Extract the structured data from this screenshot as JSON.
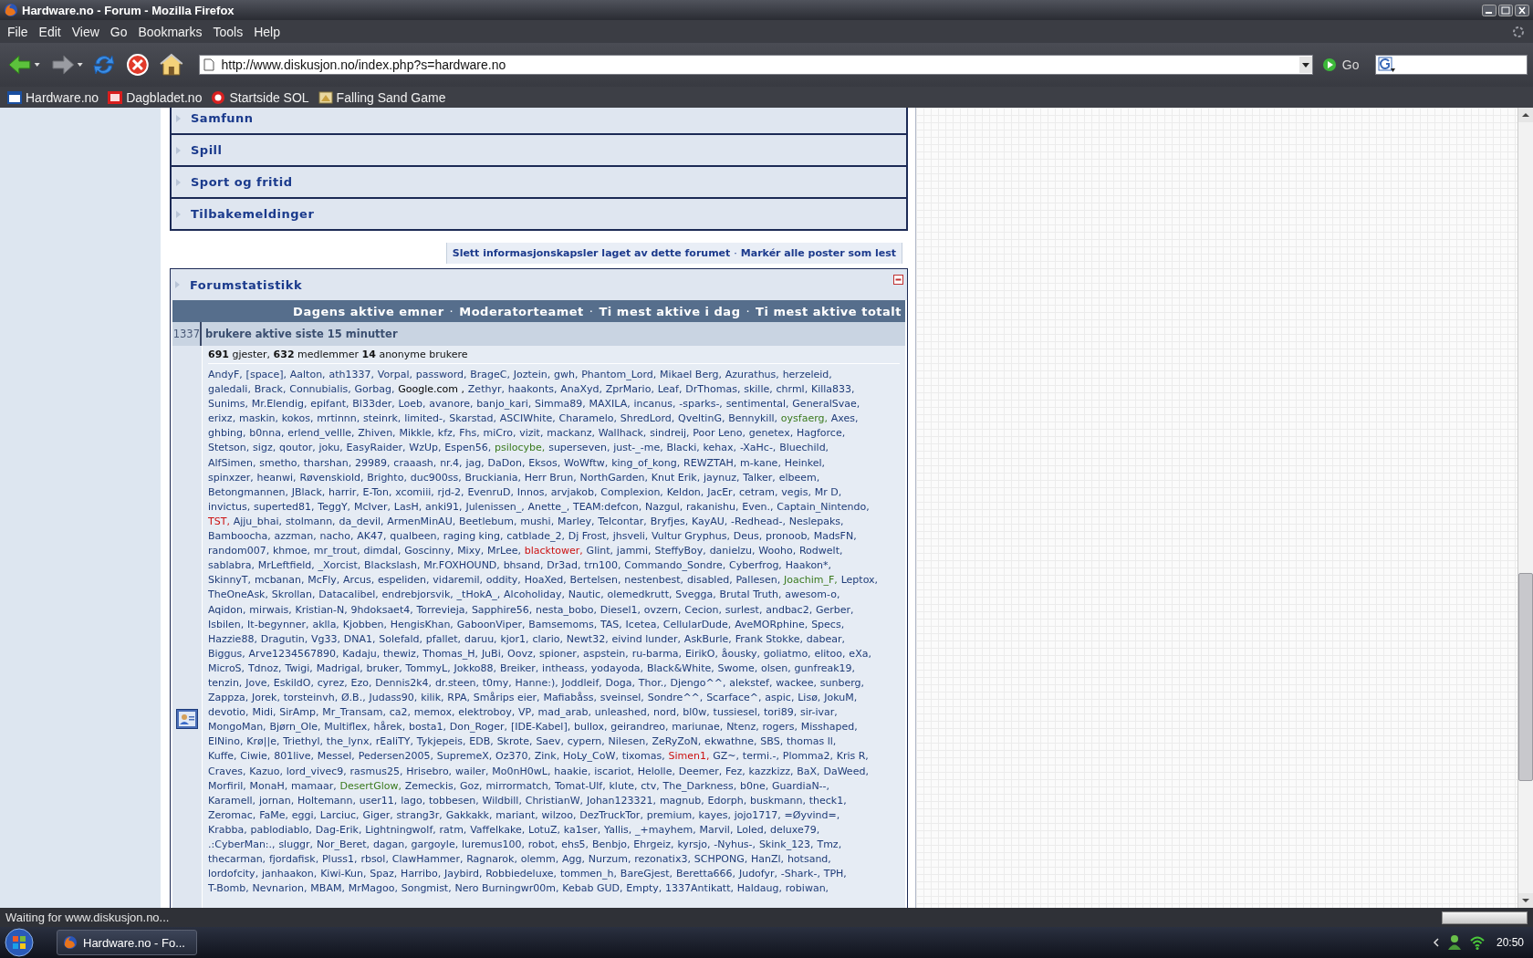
{
  "window": {
    "title": "Hardware.no - Forum - Mozilla Firefox"
  },
  "menu": [
    "File",
    "Edit",
    "View",
    "Go",
    "Bookmarks",
    "Tools",
    "Help"
  ],
  "toolbar": {
    "address": "http://www.diskusjon.no/index.php?s=hardware.no",
    "go": "Go"
  },
  "bookmarks": [
    "Hardware.no",
    "Dagbladet.no",
    "Startside SOL",
    "Falling Sand Game"
  ],
  "forum": {
    "categories": [
      "Samfunn",
      "Spill",
      "Sport og fritid",
      "Tilbakemeldinger"
    ],
    "links": [
      {
        "kind": "link",
        "text": "Slett informasjonskapsler laget av dette forumet"
      },
      {
        "kind": "separator",
        "text": "·"
      },
      {
        "kind": "link",
        "text": "Markér alle poster som lest"
      }
    ],
    "stats": {
      "title": "Forumstatistikk",
      "bar_links": [
        {
          "kind": "link",
          "text": "Dagens aktive emner"
        },
        {
          "kind": "separator",
          "text": "·"
        },
        {
          "kind": "link",
          "text": "Moderatorteamet"
        },
        {
          "kind": "separator",
          "text": "·"
        },
        {
          "kind": "link",
          "text": "Ti mest aktive i dag"
        },
        {
          "kind": "separator",
          "text": "·"
        },
        {
          "kind": "link",
          "text": "Ti mest aktive totalt"
        }
      ],
      "active_count": "1337",
      "active_label": "brukere aktive siste 15 minutter",
      "summary": "**691** gjester, **632** medlemmer **14** anonyme brukere",
      "user_lines": [
        [
          {
            "name": "AndyF,"
          },
          {
            "name": "[space],"
          },
          {
            "name": "Aalton,"
          },
          {
            "name": "ath1337,"
          },
          {
            "name": "Vorpal,"
          },
          {
            "name": "password,"
          },
          {
            "name": "BrageC,"
          },
          {
            "name": "Joztein,"
          },
          {
            "name": "gwh,"
          },
          {
            "name": "Phantom_Lord,"
          },
          {
            "name": "Mikael Berg,"
          },
          {
            "name": "Azurathus,"
          },
          {
            "name": "herzeleid,"
          }
        ],
        [
          {
            "name": "galedali,"
          },
          {
            "name": "Brack,"
          },
          {
            "name": "Connubialis,"
          },
          {
            "name": "Gorbag,"
          },
          {
            "name": "Google.com ,",
            "color": "#000000"
          },
          {
            "name": "Zethyr,"
          },
          {
            "name": "haakonts,"
          },
          {
            "name": "AnaXyd,"
          },
          {
            "name": "ZprMario,"
          },
          {
            "name": "Leaf,"
          },
          {
            "name": "DrThomas,"
          },
          {
            "name": "skille,"
          },
          {
            "name": "chrml,"
          },
          {
            "name": "Killa833,"
          }
        ],
        [
          {
            "name": "Sunims,"
          },
          {
            "name": "Mr.Elendig,"
          },
          {
            "name": "epifant,"
          },
          {
            "name": "Bl33der,"
          },
          {
            "name": "Loeb,"
          },
          {
            "name": "avanore,"
          },
          {
            "name": "banjo_kari,"
          },
          {
            "name": "Simma89,"
          },
          {
            "name": "MAXILA,"
          },
          {
            "name": "incanus,"
          },
          {
            "name": "-sparks-,"
          },
          {
            "name": "sentimental,"
          },
          {
            "name": "GeneralSvae,"
          }
        ],
        [
          {
            "name": "erixz,"
          },
          {
            "name": "maskin,"
          },
          {
            "name": "kokos,"
          },
          {
            "name": "mrtinnn,"
          },
          {
            "name": "steinrk,"
          },
          {
            "name": "limited-,"
          },
          {
            "name": "Skarstad,"
          },
          {
            "name": "ASCIWhite,"
          },
          {
            "name": "Charamelo,"
          },
          {
            "name": "ShredLord,"
          },
          {
            "name": "QveltinG,"
          },
          {
            "name": "Bennykill,"
          },
          {
            "name": "oysfaerg,",
            "color": "#3a7a1e"
          },
          {
            "name": "Axes,"
          }
        ],
        [
          {
            "name": "ghbing,"
          },
          {
            "name": "b0nna,"
          },
          {
            "name": "erlend_vellle,"
          },
          {
            "name": "Zhiven,"
          },
          {
            "name": "Mikkle,"
          },
          {
            "name": "kfz,"
          },
          {
            "name": "Fhs,"
          },
          {
            "name": "miCro,"
          },
          {
            "name": "vizit,"
          },
          {
            "name": "mackanz,"
          },
          {
            "name": "Wallhack,"
          },
          {
            "name": "sindreij,"
          },
          {
            "name": "Poor Leno,"
          },
          {
            "name": "genetex,"
          },
          {
            "name": "Hagforce,"
          }
        ],
        [
          {
            "name": "Stetson,"
          },
          {
            "name": "sigz,"
          },
          {
            "name": "qoutor,"
          },
          {
            "name": "joku,"
          },
          {
            "name": "EasyRaider,"
          },
          {
            "name": "WzUp,"
          },
          {
            "name": "Espen56,"
          },
          {
            "name": "psilocybe,",
            "color": "#3a7a1e"
          },
          {
            "name": "superseven,"
          },
          {
            "name": "just-_-me,"
          },
          {
            "name": "Blacki,"
          },
          {
            "name": "kehax,"
          },
          {
            "name": "-XaHc-,"
          },
          {
            "name": "Bluechild,"
          }
        ],
        [
          {
            "name": "AlfSimen,"
          },
          {
            "name": "smetho,"
          },
          {
            "name": "tharshan,"
          },
          {
            "name": "29989,"
          },
          {
            "name": "craaash,"
          },
          {
            "name": "nr.4,"
          },
          {
            "name": "jag,"
          },
          {
            "name": "DaDon,"
          },
          {
            "name": "Eksos,"
          },
          {
            "name": "WoWftw,"
          },
          {
            "name": "king_of_kong,"
          },
          {
            "name": "REWZTAH,"
          },
          {
            "name": "m-kane,"
          },
          {
            "name": "Heinkel,"
          }
        ],
        [
          {
            "name": "spinxzer,"
          },
          {
            "name": "heanwi,"
          },
          {
            "name": "Røvenskiold,"
          },
          {
            "name": "Brighto,"
          },
          {
            "name": "duc900ss,"
          },
          {
            "name": "Bruckiania,"
          },
          {
            "name": "Herr Brun,"
          },
          {
            "name": "NorthGarden,"
          },
          {
            "name": "Knut Erik,"
          },
          {
            "name": "jaynuz,"
          },
          {
            "name": "Talker,"
          },
          {
            "name": "elbeem,"
          }
        ],
        [
          {
            "name": "Betongmannen,"
          },
          {
            "name": "JBlack,"
          },
          {
            "name": "harrir,"
          },
          {
            "name": "E-Ton,"
          },
          {
            "name": "xcomiii,"
          },
          {
            "name": "rjd-2,"
          },
          {
            "name": "EvenruD,"
          },
          {
            "name": "Innos,"
          },
          {
            "name": "arvjakob,"
          },
          {
            "name": "Complexion,"
          },
          {
            "name": "Keldon,"
          },
          {
            "name": "JacEr,"
          },
          {
            "name": "cetram,"
          },
          {
            "name": "vegis,"
          },
          {
            "name": "Mr D,"
          }
        ],
        [
          {
            "name": "invictus,"
          },
          {
            "name": "superted81,"
          },
          {
            "name": "TeggY,"
          },
          {
            "name": "McIver,"
          },
          {
            "name": "LasH,"
          },
          {
            "name": "anki91,"
          },
          {
            "name": "Julenissen_,"
          },
          {
            "name": "Anette_,"
          },
          {
            "name": "TEAM:defcon,"
          },
          {
            "name": "Nazgul,"
          },
          {
            "name": "rakanishu,"
          },
          {
            "name": "Even.,"
          },
          {
            "name": "Captain_Nintendo,"
          }
        ],
        [
          {
            "name": "TST,",
            "color": "#cc1111"
          },
          {
            "name": "Ajju_bhai,"
          },
          {
            "name": "stolmann,"
          },
          {
            "name": "da_devil,"
          },
          {
            "name": "ArmenMinAU,"
          },
          {
            "name": "Beetlebum,"
          },
          {
            "name": "mushi,"
          },
          {
            "name": "Marley,"
          },
          {
            "name": "Telcontar,"
          },
          {
            "name": "Bryfjes,"
          },
          {
            "name": "KayAU,"
          },
          {
            "name": "-Redhead-,"
          },
          {
            "name": "Neslepaks,"
          }
        ],
        [
          {
            "name": "Bamboocha,"
          },
          {
            "name": "azzman,"
          },
          {
            "name": "nacho,"
          },
          {
            "name": "AK47,"
          },
          {
            "name": "qualbeen,"
          },
          {
            "name": "raging king,"
          },
          {
            "name": "catblade_2,"
          },
          {
            "name": "Dj Frost,"
          },
          {
            "name": "jhsveli,"
          },
          {
            "name": "Vultur Gryphus,"
          },
          {
            "name": "Deus,"
          },
          {
            "name": "pronoob,"
          },
          {
            "name": "MadsFN,"
          }
        ],
        [
          {
            "name": "random007,"
          },
          {
            "name": "khmoe,"
          },
          {
            "name": "mr_trout,"
          },
          {
            "name": "dimdal,"
          },
          {
            "name": "Goscinny,"
          },
          {
            "name": "Mixy,"
          },
          {
            "name": "MrLee,"
          },
          {
            "name": "blacktower,",
            "color": "#cc1111"
          },
          {
            "name": "Glint,"
          },
          {
            "name": "jammi,"
          },
          {
            "name": "SteffyBoy,"
          },
          {
            "name": "danielzu,"
          },
          {
            "name": "Wooho,"
          },
          {
            "name": "Rodwelt,"
          }
        ],
        [
          {
            "name": "sablabra,"
          },
          {
            "name": "MrLeftfield,"
          },
          {
            "name": "_Xorcist,"
          },
          {
            "name": "Blackslash,"
          },
          {
            "name": "Mr.FOXHOUND,"
          },
          {
            "name": "bhsand,"
          },
          {
            "name": "Dr3ad,"
          },
          {
            "name": "trn100,"
          },
          {
            "name": "Commando_Sondre,"
          },
          {
            "name": "Cyberfrog,"
          },
          {
            "name": "Haakon*,"
          }
        ],
        [
          {
            "name": "SkinnyT,"
          },
          {
            "name": "mcbanan,"
          },
          {
            "name": "McFly,"
          },
          {
            "name": "Arcus,"
          },
          {
            "name": "espeliden,"
          },
          {
            "name": "vidaremil,"
          },
          {
            "name": "oddity,"
          },
          {
            "name": "HoaXed,"
          },
          {
            "name": "Bertelsen,"
          },
          {
            "name": "nestenbest,"
          },
          {
            "name": "disabled,"
          },
          {
            "name": "Pallesen,"
          },
          {
            "name": "Joachim_F,",
            "color": "#3a7a1e"
          },
          {
            "name": "Leptox,"
          }
        ],
        [
          {
            "name": "TheOneAsk,"
          },
          {
            "name": "Skrollan,"
          },
          {
            "name": "Datacalibel,"
          },
          {
            "name": "endrebjorsvik,"
          },
          {
            "name": "_tHokA_,"
          },
          {
            "name": "Alcoholiday,"
          },
          {
            "name": "Nautic,"
          },
          {
            "name": "olemedkrutt,"
          },
          {
            "name": "Svegga,"
          },
          {
            "name": "Brutal Truth,"
          },
          {
            "name": "awesom-o,"
          }
        ],
        [
          {
            "name": "Aqidon,"
          },
          {
            "name": "mirwais,"
          },
          {
            "name": "Kristian-N,"
          },
          {
            "name": "9hdoksaet4,"
          },
          {
            "name": "Torrevieja,"
          },
          {
            "name": "Sapphire56,"
          },
          {
            "name": "nesta_bobo,"
          },
          {
            "name": "Diesel1,"
          },
          {
            "name": "ovzern,"
          },
          {
            "name": "Cecion,"
          },
          {
            "name": "surlest,"
          },
          {
            "name": "andbac2,"
          },
          {
            "name": "Gerber,"
          }
        ],
        [
          {
            "name": "Isbilen,"
          },
          {
            "name": "It-begynner,"
          },
          {
            "name": "aklla,"
          },
          {
            "name": "Kjobben,"
          },
          {
            "name": "HengisKhan,"
          },
          {
            "name": "GaboonViper,"
          },
          {
            "name": "Bamsemoms,"
          },
          {
            "name": "TAS,"
          },
          {
            "name": "Icetea,"
          },
          {
            "name": "CellularDude,"
          },
          {
            "name": "AveMORphine,"
          },
          {
            "name": "Specs,"
          }
        ],
        [
          {
            "name": "Hazzie88,"
          },
          {
            "name": "Dragutin,"
          },
          {
            "name": "Vg33,"
          },
          {
            "name": "DNA1,"
          },
          {
            "name": "Solefald,"
          },
          {
            "name": "pfallet,"
          },
          {
            "name": "daruu,"
          },
          {
            "name": "kjor1,"
          },
          {
            "name": "clario,"
          },
          {
            "name": "Newt32,"
          },
          {
            "name": "eivind lunder,"
          },
          {
            "name": "AskBurle,"
          },
          {
            "name": "Frank Stokke,"
          },
          {
            "name": "dabear,"
          }
        ],
        [
          {
            "name": "Biggus,"
          },
          {
            "name": "Arve1234567890,"
          },
          {
            "name": "Kadaju,"
          },
          {
            "name": "thewiz,"
          },
          {
            "name": "Thomas_H,"
          },
          {
            "name": "JuBi,"
          },
          {
            "name": "Oovz,"
          },
          {
            "name": "spioner,"
          },
          {
            "name": "aspstein,"
          },
          {
            "name": "ru-barma,"
          },
          {
            "name": "EirikO,"
          },
          {
            "name": "åousky,"
          },
          {
            "name": "goliatmo,"
          },
          {
            "name": "elitoo,"
          },
          {
            "name": "eXa,"
          }
        ],
        [
          {
            "name": "MicroS,"
          },
          {
            "name": "Tdnoz,"
          },
          {
            "name": "Twigi,"
          },
          {
            "name": "Madrigal,"
          },
          {
            "name": "bruker,"
          },
          {
            "name": "TommyL,"
          },
          {
            "name": "Jokko88,"
          },
          {
            "name": "Breiker,"
          },
          {
            "name": "intheass,"
          },
          {
            "name": "yodayoda,"
          },
          {
            "name": "Black&White,"
          },
          {
            "name": "Swome,"
          },
          {
            "name": "olsen,"
          },
          {
            "name": "gunfreak19,"
          }
        ],
        [
          {
            "name": "tenzin,"
          },
          {
            "name": "Jove,"
          },
          {
            "name": "EskildO,"
          },
          {
            "name": "cyrez,"
          },
          {
            "name": "Ezo,"
          },
          {
            "name": "Dennis2k4,"
          },
          {
            "name": "dr.steen,"
          },
          {
            "name": "t0my,"
          },
          {
            "name": "Hanne:),"
          },
          {
            "name": "Joddleif,"
          },
          {
            "name": "Doga,"
          },
          {
            "name": "Thor.,"
          },
          {
            "name": "Djengo^^,"
          },
          {
            "name": "alekstef,"
          },
          {
            "name": "wackee,"
          },
          {
            "name": "sunberg,"
          }
        ],
        [
          {
            "name": "Zappza,"
          },
          {
            "name": "Jorek,"
          },
          {
            "name": "torsteinvh,"
          },
          {
            "name": "Ø.B.,"
          },
          {
            "name": "Judass90,"
          },
          {
            "name": "kilik,"
          },
          {
            "name": "RPA,"
          },
          {
            "name": "Smårips eier,"
          },
          {
            "name": "Mafiabåss,"
          },
          {
            "name": "sveinsel,"
          },
          {
            "name": "Sondre^^,"
          },
          {
            "name": "Scarface^,"
          },
          {
            "name": "aspic,"
          },
          {
            "name": "Lisø,"
          },
          {
            "name": "JokuM,"
          }
        ],
        [
          {
            "name": "devotio,"
          },
          {
            "name": "Midi,"
          },
          {
            "name": "SirAmp,"
          },
          {
            "name": "Mr_Transam,"
          },
          {
            "name": "ca2,"
          },
          {
            "name": "memox,"
          },
          {
            "name": "elektroboy,"
          },
          {
            "name": "VP,"
          },
          {
            "name": "mad_arab,"
          },
          {
            "name": "unleashed,"
          },
          {
            "name": "nord,"
          },
          {
            "name": "bl0w,"
          },
          {
            "name": "tussiesel,"
          },
          {
            "name": "tori89,"
          },
          {
            "name": "sir-ivar,"
          }
        ],
        [
          {
            "name": "MongoMan,"
          },
          {
            "name": "Bjørn_Ole,"
          },
          {
            "name": "Multiflex,"
          },
          {
            "name": "hårek,"
          },
          {
            "name": "bosta1,"
          },
          {
            "name": "Don_Roger,"
          },
          {
            "name": "[IDE-Kabel],"
          },
          {
            "name": "bullox,"
          },
          {
            "name": "geirandreo,"
          },
          {
            "name": "mariunae,"
          },
          {
            "name": "Ntenz,"
          },
          {
            "name": "rogers,"
          },
          {
            "name": "Misshaped,"
          }
        ],
        [
          {
            "name": "ElNino,"
          },
          {
            "name": "Krø||e,"
          },
          {
            "name": "Triethyl,"
          },
          {
            "name": "the_lynx,"
          },
          {
            "name": "rEaliTY,"
          },
          {
            "name": "Tykjepeis,"
          },
          {
            "name": "EDB,"
          },
          {
            "name": "Skrote,"
          },
          {
            "name": "Saev,"
          },
          {
            "name": "cypern,"
          },
          {
            "name": "Nilesen,"
          },
          {
            "name": "ZeRyZoN,"
          },
          {
            "name": "ekwathne,"
          },
          {
            "name": "SBS,"
          },
          {
            "name": "thomas ll,"
          }
        ],
        [
          {
            "name": "Kuffe,"
          },
          {
            "name": "Ciwie,"
          },
          {
            "name": "801live,"
          },
          {
            "name": "Messel,"
          },
          {
            "name": "Pedersen2005,"
          },
          {
            "name": "SupremeX,"
          },
          {
            "name": "Oz370,"
          },
          {
            "name": "Zink,"
          },
          {
            "name": "HoLy_CoW,"
          },
          {
            "name": "tixomas,"
          },
          {
            "name": "Simen1,",
            "color": "#cc1111"
          },
          {
            "name": "GZ~,"
          },
          {
            "name": "termi.-,"
          },
          {
            "name": "Plomma2,"
          },
          {
            "name": "Kris R,"
          }
        ],
        [
          {
            "name": "Craves,"
          },
          {
            "name": "Kazuo,"
          },
          {
            "name": "lord_vivec9,"
          },
          {
            "name": "rasmus25,"
          },
          {
            "name": "Hrisebro,"
          },
          {
            "name": "wailer,"
          },
          {
            "name": "Mo0nH0wL,"
          },
          {
            "name": "haakie,"
          },
          {
            "name": "iscariot,"
          },
          {
            "name": "Helolle,"
          },
          {
            "name": "Deemer,"
          },
          {
            "name": "Fez,"
          },
          {
            "name": "kazzkizz,"
          },
          {
            "name": "BaX,"
          },
          {
            "name": "DaWeed,"
          }
        ],
        [
          {
            "name": "Morfiril,"
          },
          {
            "name": "MonaH,"
          },
          {
            "name": "mamaar,"
          },
          {
            "name": "DesertGlow,",
            "color": "#3a7a1e"
          },
          {
            "name": "Zemeckis,"
          },
          {
            "name": "Goz,"
          },
          {
            "name": "mirrormatch,"
          },
          {
            "name": "Tomat-Ulf,"
          },
          {
            "name": "klute,"
          },
          {
            "name": "ctv,"
          },
          {
            "name": "The_Darkness,"
          },
          {
            "name": "b0ne,"
          },
          {
            "name": "GuardiaN--,"
          }
        ],
        [
          {
            "name": "Karamell,"
          },
          {
            "name": "jornan,"
          },
          {
            "name": "Holtemann,"
          },
          {
            "name": "user11,"
          },
          {
            "name": "lago,"
          },
          {
            "name": "tobbesen,"
          },
          {
            "name": "Wildbill,"
          },
          {
            "name": "ChristianW,"
          },
          {
            "name": "Johan123321,"
          },
          {
            "name": "magnub,"
          },
          {
            "name": "Edorph,"
          },
          {
            "name": "buskmann,"
          },
          {
            "name": "theck1,"
          }
        ],
        [
          {
            "name": "Zeromac,"
          },
          {
            "name": "FaMe,"
          },
          {
            "name": "eggi,"
          },
          {
            "name": "Larciuc,"
          },
          {
            "name": "Giger,"
          },
          {
            "name": "strang3r,"
          },
          {
            "name": "Gakkakk,"
          },
          {
            "name": "mariant,"
          },
          {
            "name": "wilzoo,"
          },
          {
            "name": "DezTruckTor,"
          },
          {
            "name": "premium,"
          },
          {
            "name": "kayes,"
          },
          {
            "name": "jojo1717,"
          },
          {
            "name": "=Øyvind=,"
          }
        ],
        [
          {
            "name": "Krabba,"
          },
          {
            "name": "pablodiablo,"
          },
          {
            "name": "Dag-Erik,"
          },
          {
            "name": "Lightningwolf,"
          },
          {
            "name": "ratm,"
          },
          {
            "name": "Vaffelkake,"
          },
          {
            "name": "LotuZ,"
          },
          {
            "name": "ka1ser,"
          },
          {
            "name": "Yallis,"
          },
          {
            "name": "_+mayhem,"
          },
          {
            "name": "Marvil,"
          },
          {
            "name": "Loled,"
          },
          {
            "name": "deluxe79,"
          }
        ],
        [
          {
            "name": ".:CyberMan:.,"
          },
          {
            "name": "sluggr,"
          },
          {
            "name": "Nor_Beret,"
          },
          {
            "name": "dagan,"
          },
          {
            "name": "gargoyle,"
          },
          {
            "name": "luremus100,"
          },
          {
            "name": "robot,"
          },
          {
            "name": "ehs5,"
          },
          {
            "name": "Benbjo,"
          },
          {
            "name": "Ehrgeiz,"
          },
          {
            "name": "kyrsjo,"
          },
          {
            "name": "-Nyhus-,"
          },
          {
            "name": "Skink_123,"
          },
          {
            "name": "Tmz,"
          }
        ],
        [
          {
            "name": "thecarman,"
          },
          {
            "name": "fjordafisk,"
          },
          {
            "name": "Pluss1,"
          },
          {
            "name": "rbsol,"
          },
          {
            "name": "ClawHammer,"
          },
          {
            "name": "Ragnarok,"
          },
          {
            "name": "olemm,"
          },
          {
            "name": "Agg,"
          },
          {
            "name": "Nurzum,"
          },
          {
            "name": "rezonatix3,"
          },
          {
            "name": "SCHPONG,"
          },
          {
            "name": "HanZl,"
          },
          {
            "name": "hotsand,"
          }
        ],
        [
          {
            "name": "lordofcity,"
          },
          {
            "name": "janhaakon,"
          },
          {
            "name": "Kiwi-Kun,"
          },
          {
            "name": "Spaz,"
          },
          {
            "name": "Harribo,"
          },
          {
            "name": "Jaybird,"
          },
          {
            "name": "Robbiedeluxe,"
          },
          {
            "name": "tommen_h,"
          },
          {
            "name": "BareGjest,"
          },
          {
            "name": "Beretta666,"
          },
          {
            "name": "Judofyr,"
          },
          {
            "name": "-Shark-,"
          },
          {
            "name": "TPH,"
          }
        ],
        [
          {
            "name": "T-Bomb,"
          },
          {
            "name": "Nevnarion,"
          },
          {
            "name": "MBAM,"
          },
          {
            "name": "MrMagoo,"
          },
          {
            "name": "Songmist,"
          },
          {
            "name": "Nero Burningwr00m,"
          },
          {
            "name": "Kebab GUD,"
          },
          {
            "name": "Empty,"
          },
          {
            "name": "1337Antikatt,"
          },
          {
            "name": "Haldaug,"
          },
          {
            "name": "robiwan,"
          }
        ]
      ]
    }
  },
  "status_bar": "Waiting for www.diskusjon.no...",
  "progress": {
    "level": 1
  },
  "taskbar": {
    "task": "Hardware.no - Fo...",
    "clock": "20:50"
  }
}
